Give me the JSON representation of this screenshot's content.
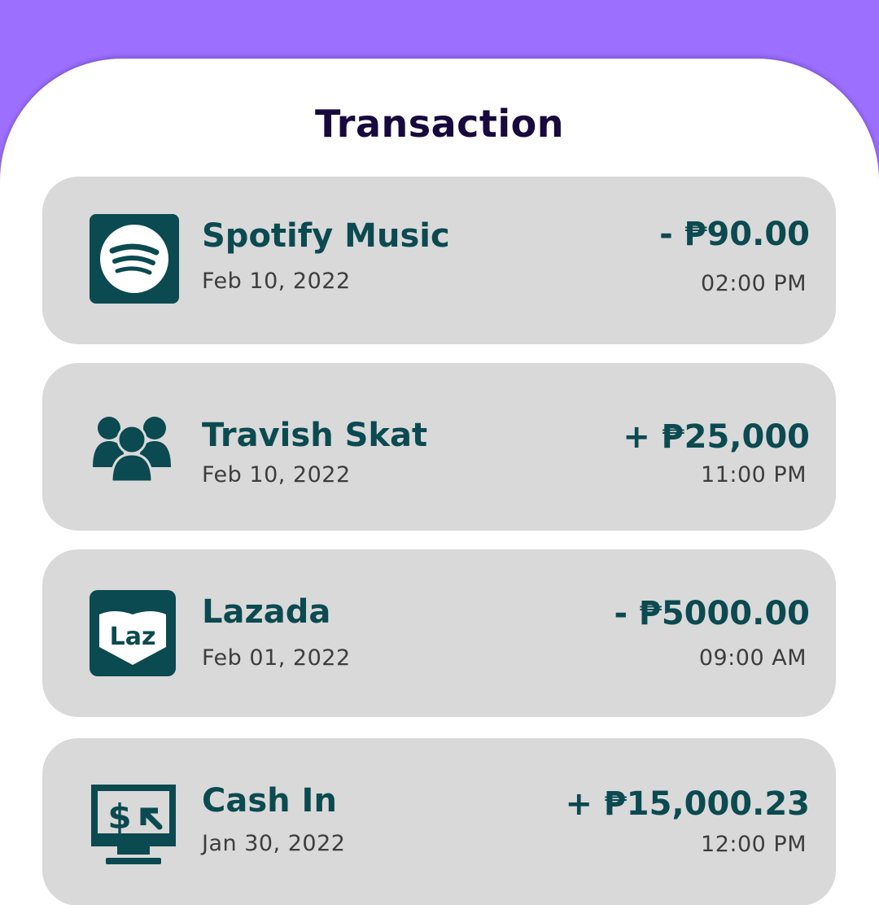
{
  "header": {
    "title": "Transaction"
  },
  "colors": {
    "accent": "#0b4a50",
    "background": "#9d6fff",
    "card": "#d9d9d9",
    "title": "#17083d"
  },
  "transactions": [
    {
      "name": "Spotify Music",
      "date": "Feb 10, 2022",
      "amount": "- ₱90.00",
      "time": "02:00 PM",
      "icon": "spotify-icon"
    },
    {
      "name": "Travish Skat",
      "date": "Feb 10, 2022",
      "amount": "+ ₱25,000",
      "time": "11:00 PM",
      "icon": "people-group-icon"
    },
    {
      "name": "Lazada",
      "date": "Feb 01, 2022",
      "amount": "- ₱5000.00",
      "time": "09:00 AM",
      "icon": "lazada-icon",
      "icon_text": "Laz"
    },
    {
      "name": "Cash In",
      "date": "Jan 30, 2022",
      "amount": "+ ₱15,000.23",
      "time": "12:00 PM",
      "icon": "cash-in-monitor-icon"
    }
  ]
}
